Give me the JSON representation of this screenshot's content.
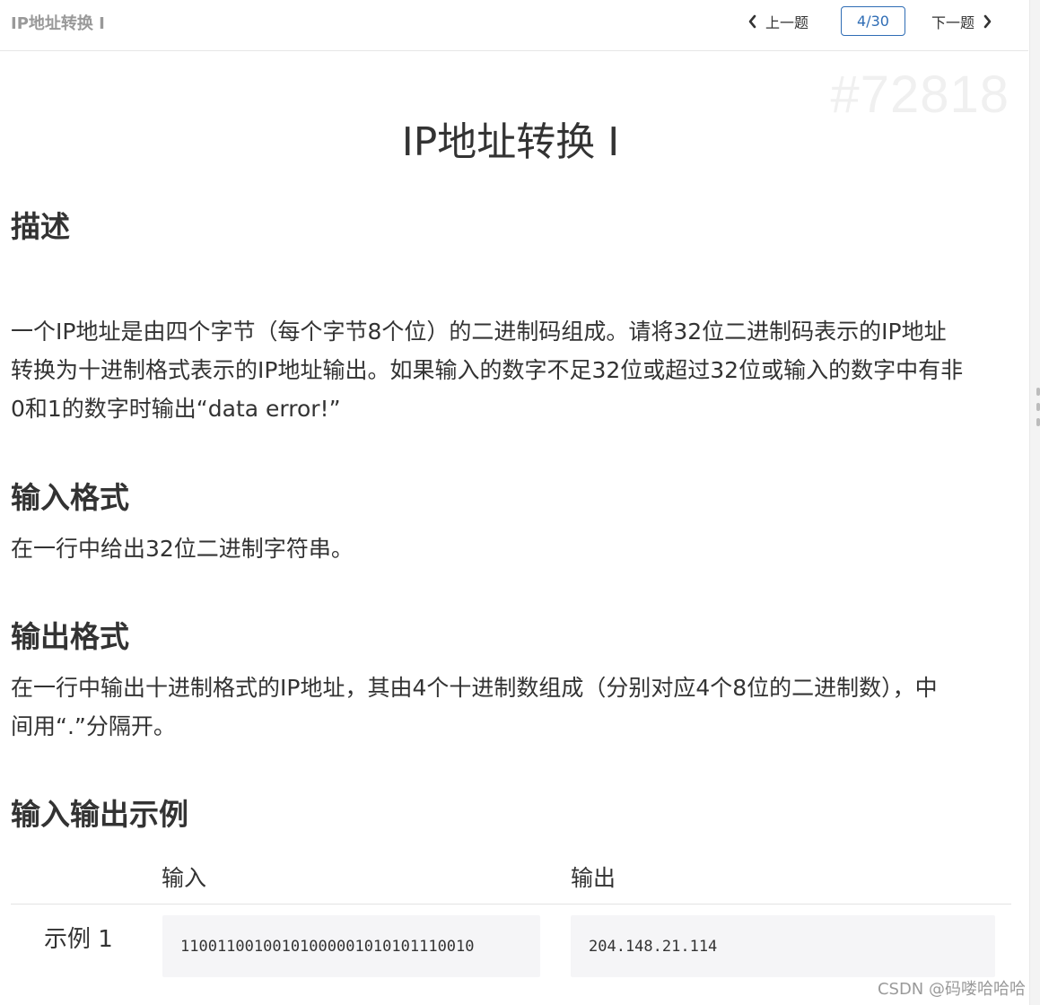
{
  "topbar": {
    "title": "IP地址转换 I",
    "prev_label": "上一题",
    "next_label": "下一题",
    "counter": "4/30"
  },
  "problem": {
    "id": "#72818",
    "title": "IP地址转换 I"
  },
  "sections": {
    "description_heading": "描述",
    "description_line1": " 一个IP地址是由四个字节（每个字节8个位）的二进制码组成。请将32位二进制码表示的IP地址",
    "description_line2": "转换为十进制格式表示的IP地址输出。如果输入的数字不足32位或超过32位或输入的数字中有非",
    "description_line3": "0和1的数字时输出“data error!”",
    "input_heading": "输入格式",
    "input_text": " 在一行中给出32位二进制字符串。",
    "output_heading": "输出格式",
    "output_line1": " 在一行中输出十进制格式的IP地址，其由4个十进制数组成（分别对应4个8位的二进制数），中",
    "output_line2": "间用“.”分隔开。",
    "examples_heading": "输入输出示例"
  },
  "examples": {
    "col_input": "输入",
    "col_output": "输出",
    "rows": [
      {
        "label": "示例 1",
        "input": "11001100100101000001010101110010",
        "output": "204.148.21.114"
      }
    ]
  },
  "watermark": "CSDN @码喽哈哈哈",
  "icons": {
    "prev": "chevron-left-icon",
    "next": "chevron-right-icon"
  }
}
